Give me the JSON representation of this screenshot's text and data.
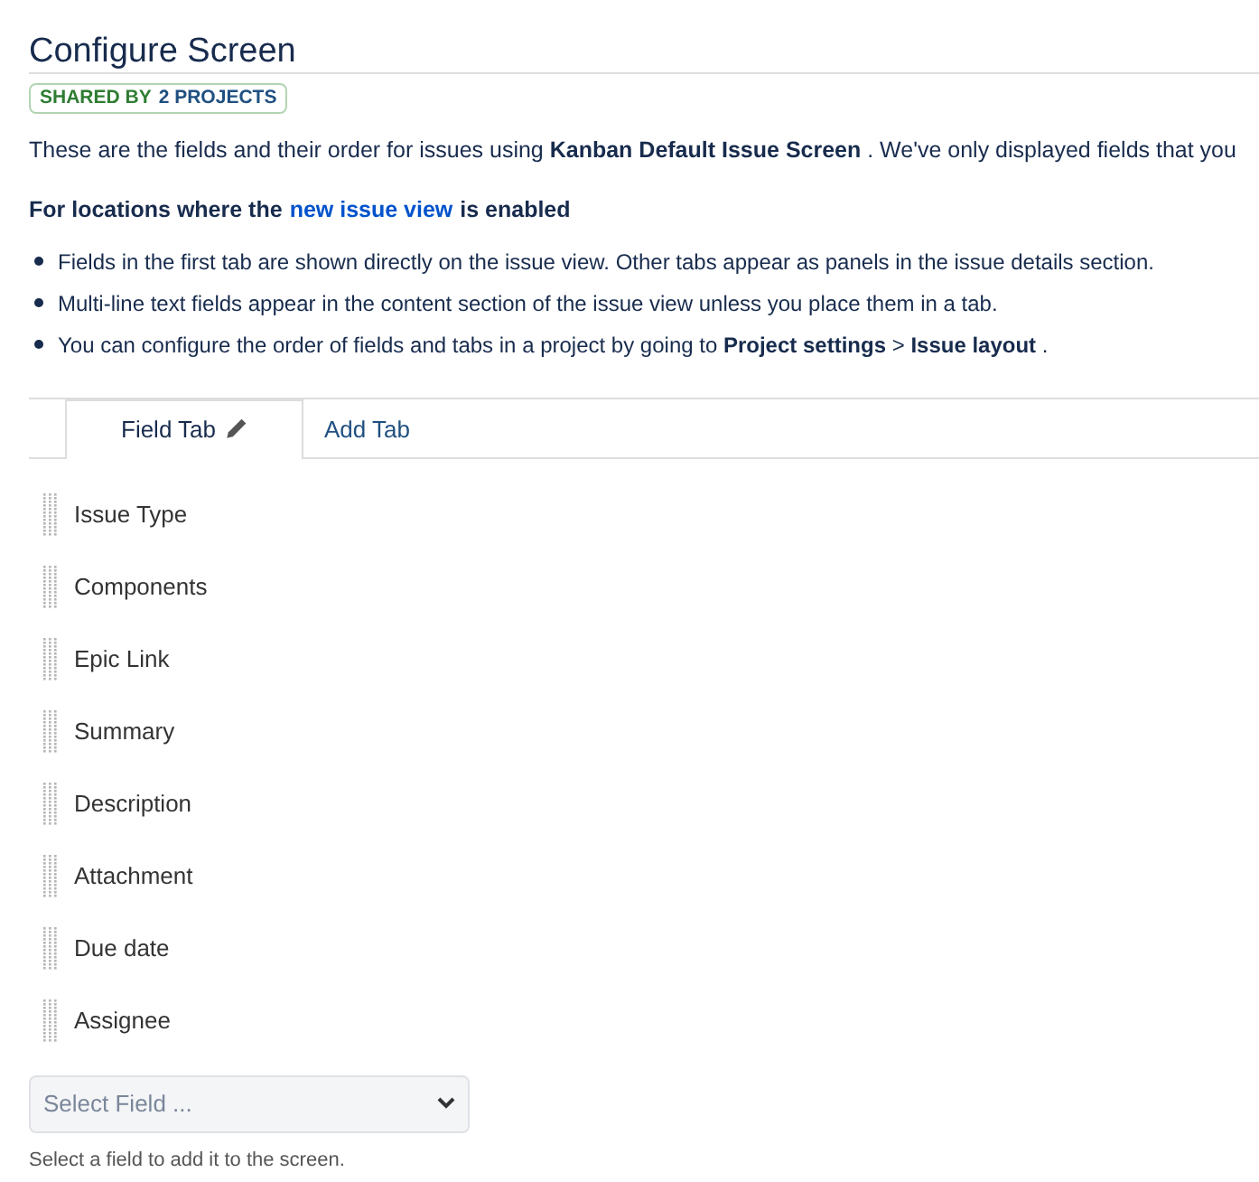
{
  "title": "Configure Screen",
  "badge": {
    "prefix": "SHARED BY",
    "suffix": "2 PROJECTS"
  },
  "intro": "These are the fields and their order for issues using **Kanban Default Issue Screen** . We've only displayed fields that you",
  "notice": {
    "before": "For locations where the",
    "link": "new issue view",
    "after": "is enabled"
  },
  "bullets": [
    "Fields in the first tab are shown directly on the issue view. Other tabs appear as panels in the issue details section.",
    "Multi-line text fields appear in the content section of the issue view unless you place them in a tab.",
    "You can configure the order of fields and tabs in a project by going to **Project settings** > **Issue layout** ."
  ],
  "tabs": [
    {
      "label": "Field Tab",
      "selected": true,
      "editable": true
    }
  ],
  "add_tab": "Add Tab",
  "fields": [
    "Issue Type",
    "Components",
    "Epic Link",
    "Summary",
    "Description",
    "Attachment",
    "Due date",
    "Assignee"
  ],
  "select": {
    "placeholder": "Select Field ..."
  },
  "help": "Select a field to add it to the screen."
}
